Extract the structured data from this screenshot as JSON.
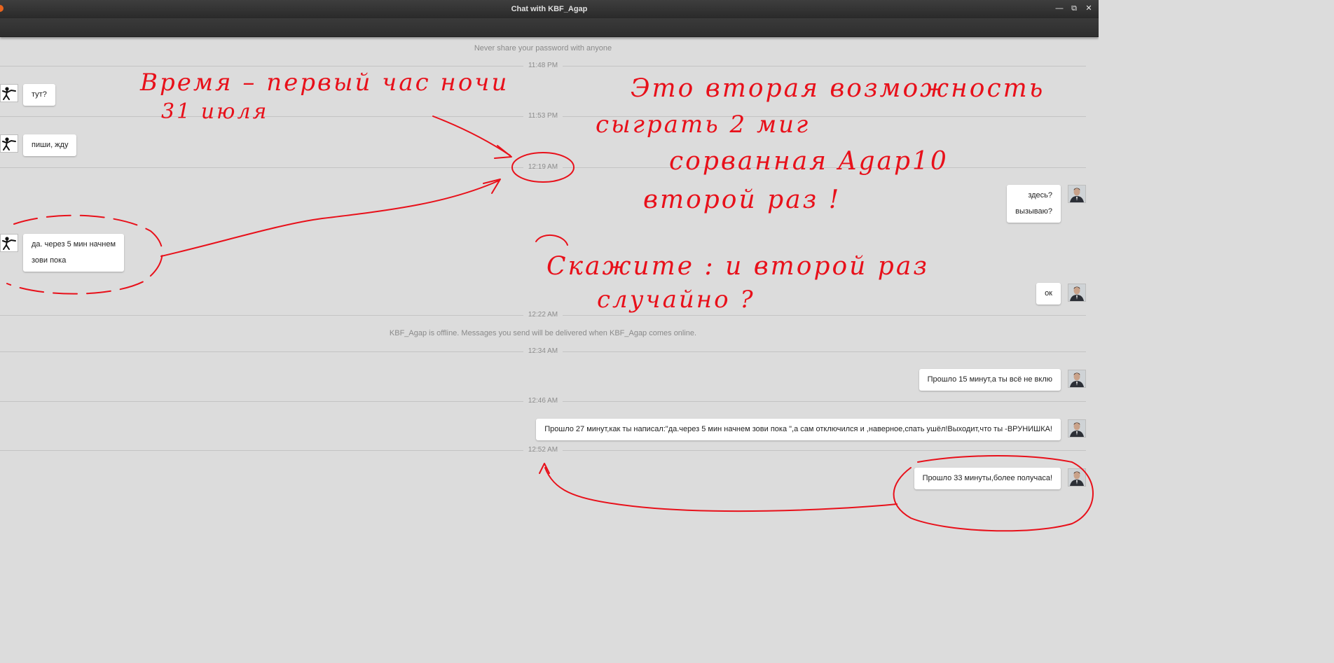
{
  "window": {
    "title": "Chat with KBF_Agap",
    "minimize_label": "—",
    "maximize_label": "⧉",
    "close_label": "✕"
  },
  "chat": {
    "top_notice": "Never share your password with anyone",
    "timestamps": [
      "11:48 PM",
      "11:53 PM",
      "12:19 AM",
      "12:22 AM",
      "12:34 AM",
      "12:46 AM",
      "12:52 AM"
    ],
    "offline_notice": "KBF_Agap is offline. Messages you send will be delivered when KBF_Agap comes online.",
    "messages": [
      {
        "side": "left",
        "lines": [
          "тут?"
        ]
      },
      {
        "side": "left",
        "lines": [
          "пиши, жду"
        ]
      },
      {
        "side": "right",
        "lines": [
          "здесь?",
          "вызываю?"
        ]
      },
      {
        "side": "left",
        "lines": [
          "да. через 5 мин начнем",
          "зови пока"
        ]
      },
      {
        "side": "right",
        "lines": [
          "ок"
        ]
      },
      {
        "side": "right",
        "lines": [
          "Прошло 15 минут,а ты всё не вклю"
        ]
      },
      {
        "side": "right",
        "lines": [
          "Прошло 27 минут,как ты написал:\"да.через 5 мин начнем  зови пока \",а сам отключился и ,наверное,спать ушёл!Выходит,что ты -ВРУНИШКА!"
        ]
      },
      {
        "side": "right",
        "lines": [
          "Прошло 33 минуты,более получаса!"
        ]
      }
    ]
  },
  "annotations": {
    "text1_line1": "Время – первый час ночи",
    "text1_line2": "31 июля",
    "text2_line1": "Это вторая возможность",
    "text2_line2": "сыграть 2 миг",
    "text2_line3": "сорванная Agap10",
    "text2_line4": "второй раз !",
    "text3_line1": "Скажите : и второй раз",
    "text3_line2": "случайно ?",
    "color": "#e8101a"
  }
}
